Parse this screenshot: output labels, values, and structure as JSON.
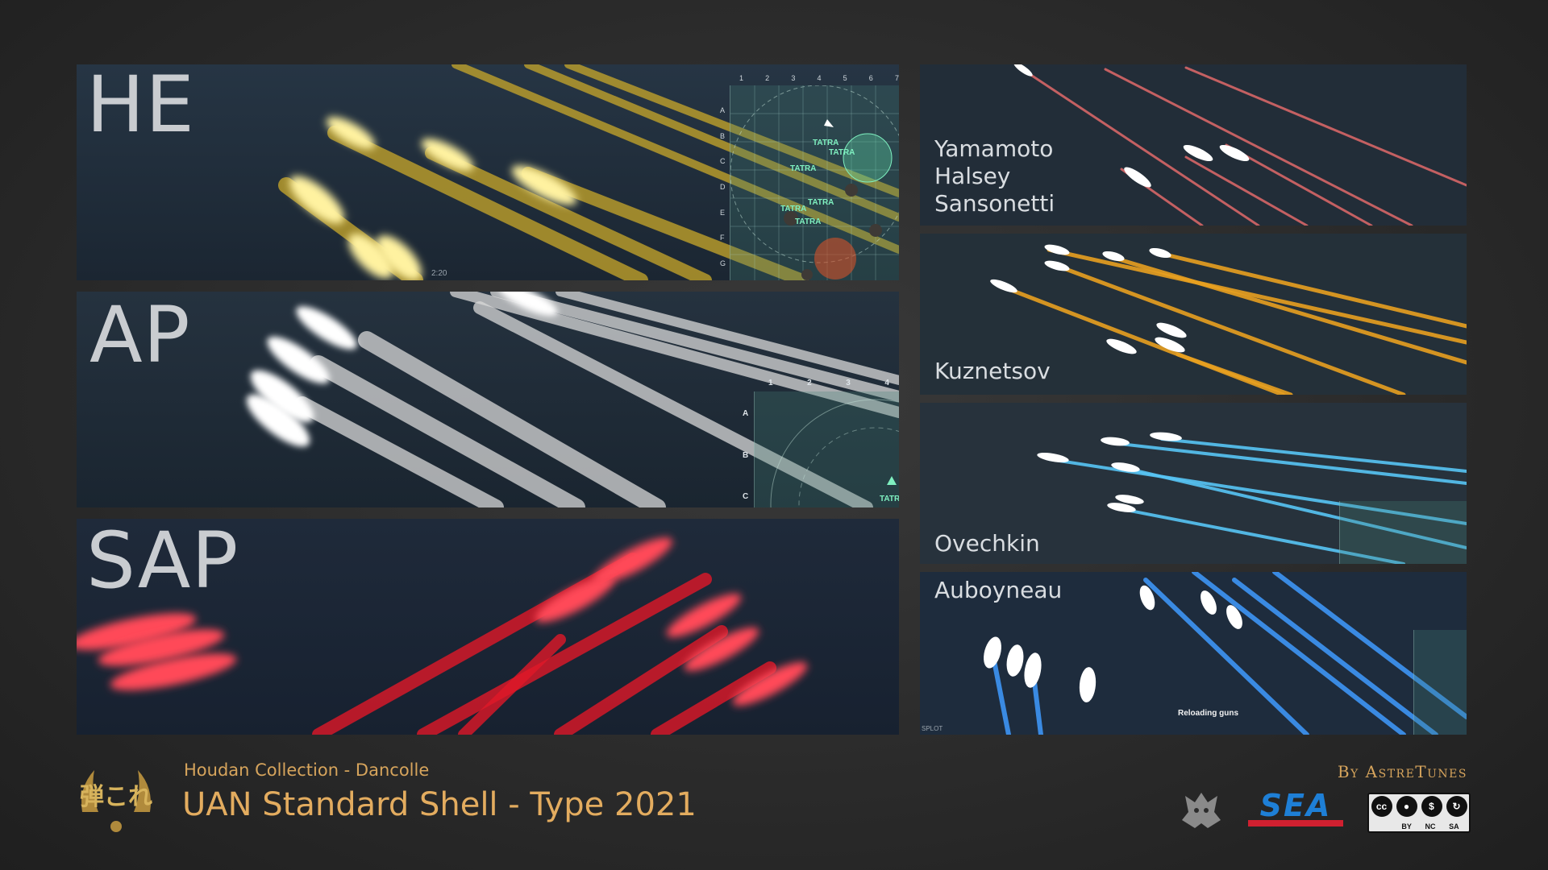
{
  "panels": {
    "he": {
      "label": "HE",
      "hud_timer": "2:20",
      "ships": [
        "TATRA",
        "TATRA",
        "TATRA",
        "TATRA",
        "TATRA",
        "TATRA"
      ]
    },
    "ap": {
      "label": "AP",
      "ship": "TATRA"
    },
    "sap": {
      "label": "SAP"
    },
    "cap1": {
      "names": [
        "Yamamoto",
        "Halsey",
        "Sansonetti"
      ]
    },
    "cap2": {
      "names": [
        "Kuznetsov"
      ]
    },
    "cap3": {
      "names": [
        "Ovechkin"
      ]
    },
    "cap4": {
      "names": [
        "Auboyneau"
      ],
      "hud_status": "Reloading guns",
      "hud_corner": "SPLOT"
    }
  },
  "minimap": {
    "columns_he": [
      "1",
      "2",
      "3",
      "4",
      "5",
      "6",
      "7"
    ],
    "rows_he": [
      "A",
      "B",
      "C",
      "D",
      "E",
      "F",
      "G"
    ],
    "columns_ap": [
      "1",
      "2",
      "3",
      "4"
    ],
    "rows_ap": [
      "A",
      "B",
      "C"
    ]
  },
  "footer": {
    "collection": "Houdan Collection - Dancolle",
    "title": "UAN Standard Shell - Type 2021",
    "author": "By AstreTunes",
    "logo_emblem_text": "弾これ",
    "sea_logo": "SEA",
    "license": {
      "tags": [
        "BY",
        "NC",
        "SA"
      ],
      "cc": "cc"
    }
  },
  "colors": {
    "he_tracer": "#f5d044",
    "ap_tracer": "#eeeeee",
    "sap_tracer": "#ff2a3a",
    "red_tracer": "#ff6a6a",
    "orange_tracer": "#ffb020",
    "cyan_tracer": "#5ecbff",
    "blue_tracer": "#3f9bff",
    "accent_text": "#e3ac5f"
  }
}
